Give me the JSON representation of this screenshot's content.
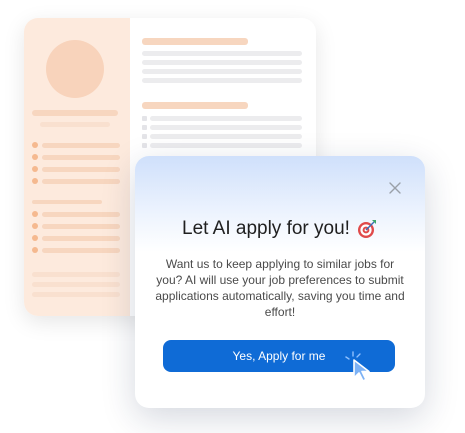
{
  "dialog": {
    "title": "Let AI apply for you!",
    "title_icon": "target-icon",
    "body": "Want us to keep applying to similar jobs for you? AI will use your job preferences to submit applications automatically, saving you time and effort!",
    "cta_label": "Yes, Apply for me",
    "close_icon": "close-icon"
  },
  "colors": {
    "cta": "#0f6bd6",
    "resume_accent": "#fdeadd",
    "gradient_top": "#cfe0fb"
  }
}
